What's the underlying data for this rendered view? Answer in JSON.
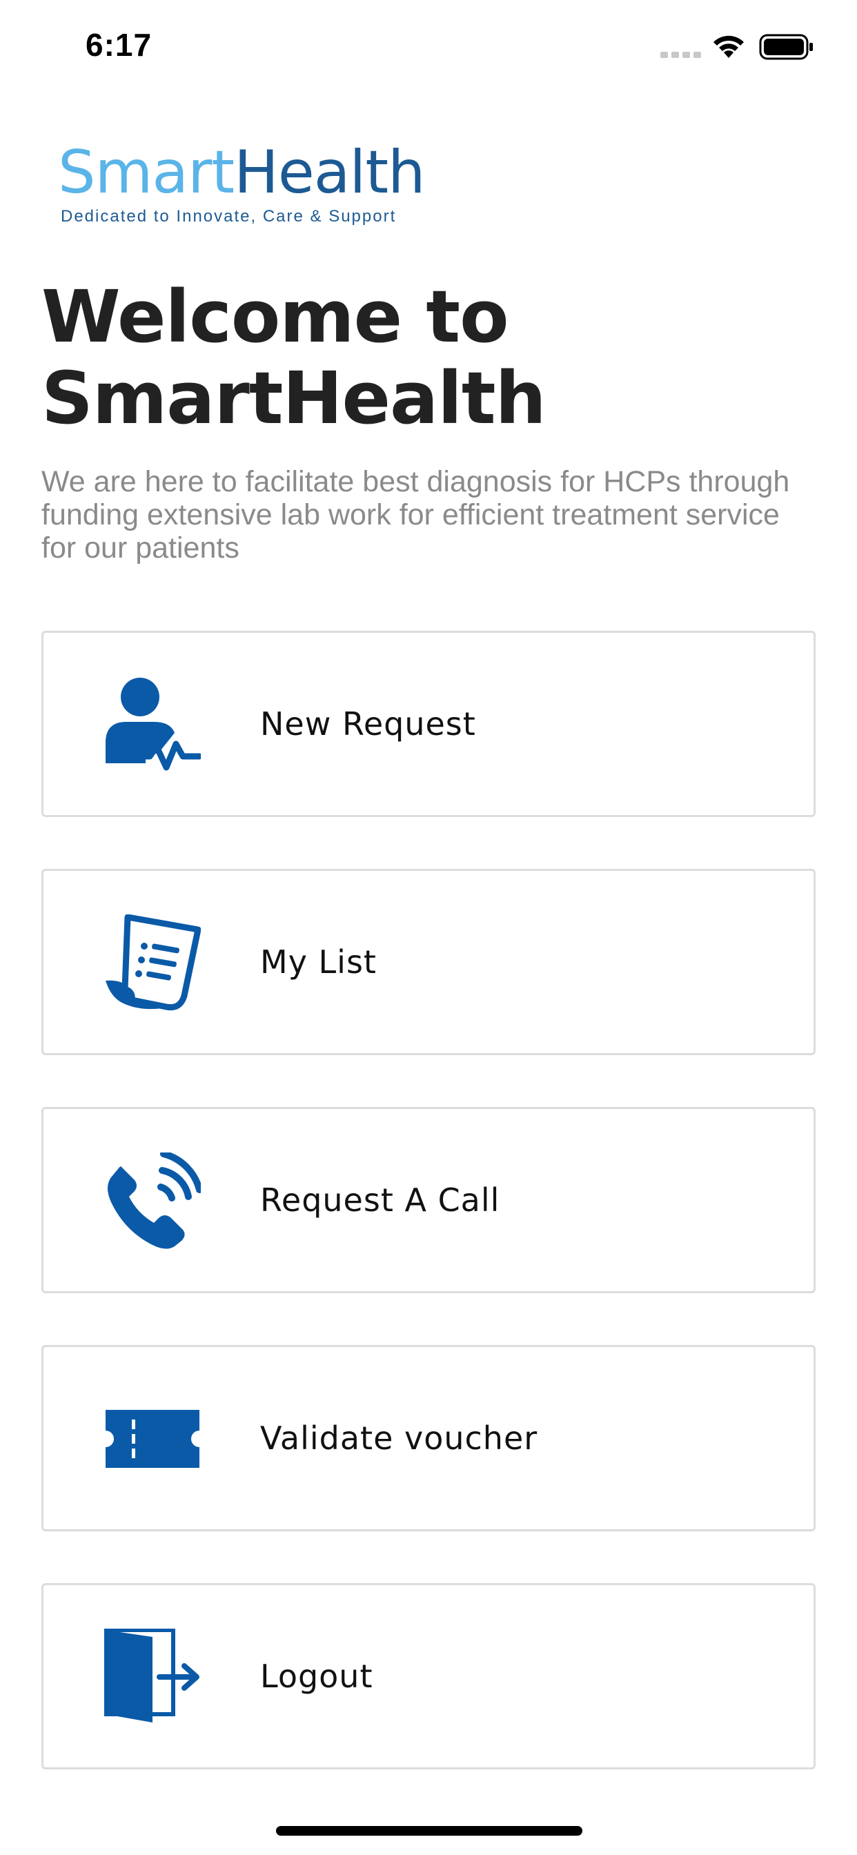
{
  "status_bar": {
    "time": "6:17"
  },
  "logo": {
    "word_part1": "Smart",
    "word_part2": "Health",
    "tagline": "Dedicated to Innovate, Care & Support"
  },
  "welcome": {
    "title_line1": "Welcome to",
    "title_line2": "SmartHealth",
    "subtitle": "We are here to facilitate best diagnosis for HCPs through funding extensive lab work for efficient treatment service for our patients"
  },
  "menu": {
    "items": [
      {
        "label": "New Request",
        "icon": "patient-heartbeat-icon"
      },
      {
        "label": "My List",
        "icon": "document-list-icon"
      },
      {
        "label": "Request A Call",
        "icon": "phone-call-icon"
      },
      {
        "label": "Validate voucher",
        "icon": "voucher-ticket-icon"
      },
      {
        "label": "Logout",
        "icon": "logout-door-icon"
      }
    ]
  },
  "colors": {
    "icon_blue": "#0b5aa8",
    "title_text": "#222222",
    "subtitle_text": "#8a8a8a",
    "card_border": "#dcdcdc",
    "logo_light": "#5ab4e8",
    "logo_dark": "#1d5a93"
  }
}
